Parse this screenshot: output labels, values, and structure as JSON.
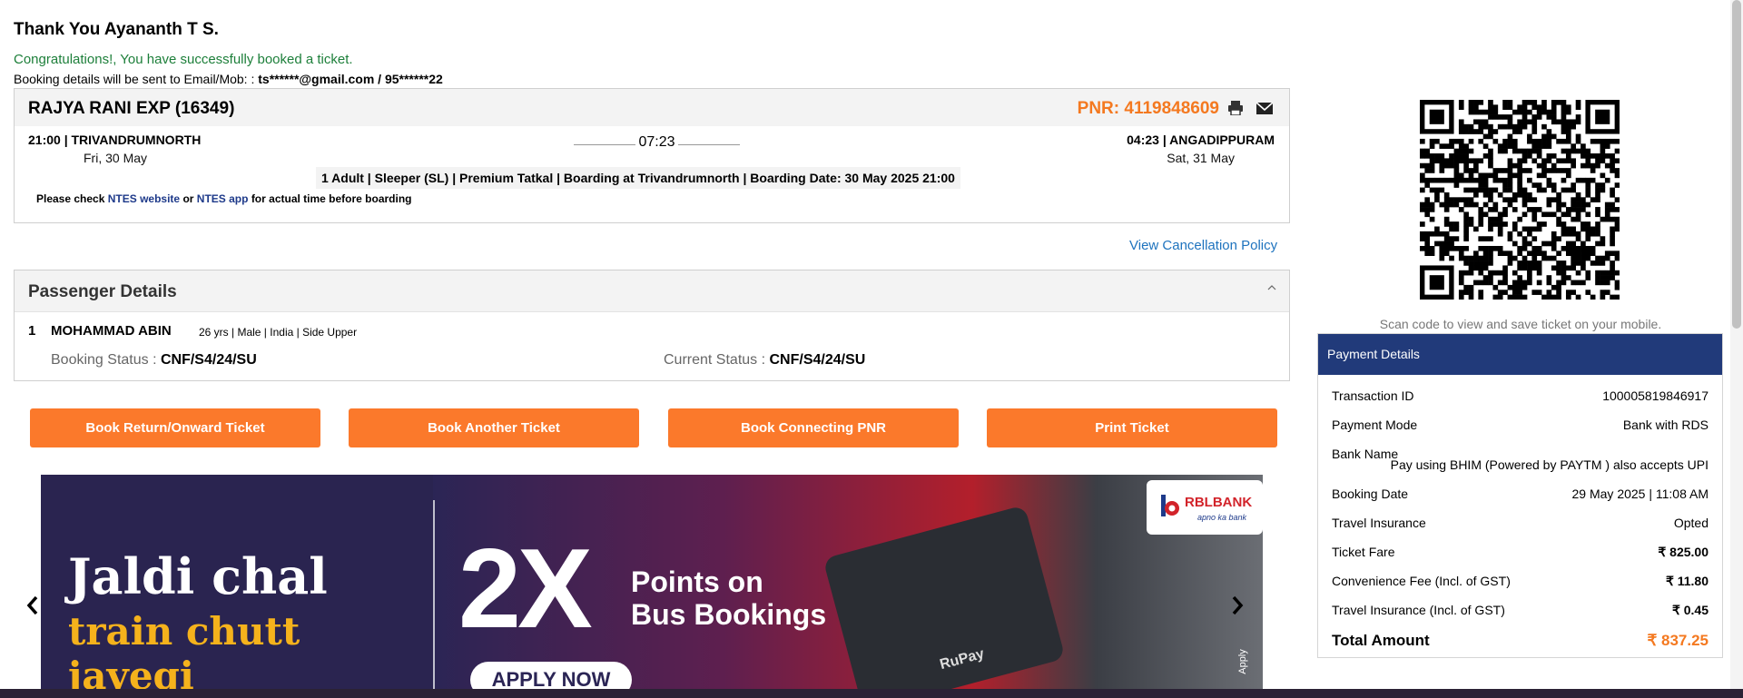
{
  "header": {
    "thank_you": "Thank You Ayananth T S.",
    "congrats": "Congratulations!, You have successfully booked a ticket.",
    "booking_sent_prefix": "Booking details will be sent to Email/Mob: :",
    "booking_sent_contact": "ts******@gmail.com / 95******22"
  },
  "train": {
    "name": "RAJYA RANI EXP (16349)",
    "pnr": "PNR: 4119848609",
    "departure": "21:00 | TRIVANDRUMNORTH",
    "departure_date": "Fri, 30 May",
    "arrival": "04:23 | ANGADIPPURAM",
    "arrival_date": "Sat, 31 May",
    "duration": "07:23",
    "journey_info": "1 Adult | Sleeper (SL) | Premium Tatkal | Boarding at Trivandrumnorth | Boarding Date: 30 May 2025 21:00",
    "ntes_prefix": "Please check",
    "ntes_website": "NTES website",
    "ntes_or": "or",
    "ntes_app": "NTES app",
    "ntes_suffix": "for actual time before boarding",
    "icons": [
      "print-icon",
      "mail-icon"
    ]
  },
  "cancellation_policy": "View Cancellation Policy",
  "passengers": {
    "title": "Passenger Details",
    "list": [
      {
        "num": "1",
        "name": "MOHAMMAD ABIN",
        "info": "26 yrs | Male | India | Side Upper",
        "booking_status_label": "Booking Status :",
        "booking_status": "CNF/S4/24/SU",
        "current_status_label": "Current Status :",
        "current_status": "CNF/S4/24/SU"
      }
    ]
  },
  "actions": {
    "return_ticket": "Book Return/Onward Ticket",
    "another_ticket": "Book Another Ticket",
    "connecting_pnr": "Book Connecting PNR",
    "print_ticket": "Print Ticket"
  },
  "banner": {
    "line1": "Jaldi chal",
    "line2": "train chutt jayegi",
    "big": "2X",
    "points_line1": "Points on",
    "points_line2": "Bus Bookings",
    "apply": "APPLY NOW",
    "bank": "RBLBANK",
    "bank_tag": "apno ka bank",
    "card_text": "RuPay",
    "side": "Apply"
  },
  "qr": {
    "caption": "Scan code to view and save ticket on your mobile."
  },
  "payment": {
    "title": "Payment Details",
    "rows": [
      {
        "label": "Transaction ID",
        "value": "100005819846917"
      },
      {
        "label": "Payment Mode",
        "value": "Bank with RDS"
      },
      {
        "label": "Bank Name",
        "value": ""
      },
      {
        "label": "Booking Date",
        "value": "29 May 2025 | 11:08 AM"
      },
      {
        "label": "Travel Insurance",
        "value": "Opted"
      },
      {
        "label": "Ticket Fare",
        "value": "₹ 825.00"
      },
      {
        "label": "Convenience Fee (Incl. of GST)",
        "value": "₹ 11.80"
      },
      {
        "label": "Travel Insurance (Incl. of GST)",
        "value": "₹ 0.45"
      }
    ],
    "bank_value": "Pay using BHIM (Powered by PAYTM ) also accepts UPI",
    "total_label": "Total Amount",
    "total_value": "₹ 837.25"
  },
  "colors": {
    "accent": "#fb792b",
    "pnr": "#f47920",
    "payment_header": "#213a7a",
    "success": "#1d7f3a",
    "link": "#1e73be"
  }
}
